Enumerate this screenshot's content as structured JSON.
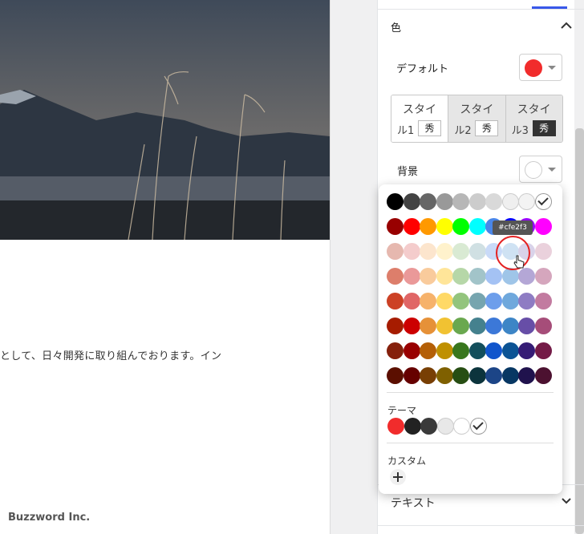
{
  "page": {
    "body_text": "として、日々開発に取り組んでおります。イン",
    "footer_brand": "Buzzword Inc."
  },
  "panel": {
    "color_heading": "色",
    "default_label": "デフォルト",
    "default_color": "#f12c2c",
    "styles": [
      {
        "line1": "スタイ",
        "line2": "ル1",
        "badge": "秀"
      },
      {
        "line1": "スタイ",
        "line2": "ル2",
        "badge": "秀"
      },
      {
        "line1": "スタイ",
        "line2": "ル3",
        "badge": "秀"
      }
    ],
    "background_label": "背景",
    "text_heading": "テキスト"
  },
  "picker": {
    "tooltip": "#cfe2f3",
    "theme_label": "テーマ",
    "custom_label": "カスタム",
    "palette": [
      [
        "#000000",
        "#434343",
        "#666666",
        "#999999",
        "#b7b7b7",
        "#cccccc",
        "#d9d9d9",
        "#efefef",
        "#f3f3f3",
        "#ffffff"
      ],
      [
        "#980000",
        "#ff0000",
        "#ff9900",
        "#ffff00",
        "#00ff00",
        "#00ffff",
        "#4a86e8",
        "#0000ff",
        "#9900ff",
        "#ff00ff"
      ],
      [
        "#e6b8af",
        "#f4cccc",
        "#fce5cd",
        "#fff2cc",
        "#d9ead3",
        "#d0e0e3",
        "#c9daf8",
        "#cfe2f3",
        "#d9d2e9",
        "#ead1dc"
      ],
      [
        "#dd7e6b",
        "#ea9999",
        "#f9cb9c",
        "#ffe599",
        "#b6d7a8",
        "#a2c4c9",
        "#a4c2f4",
        "#9fc5e8",
        "#b4a7d6",
        "#d5a6bd"
      ],
      [
        "#cc4125",
        "#e06666",
        "#f6b26b",
        "#ffd966",
        "#93c47d",
        "#76a5af",
        "#6d9eeb",
        "#6fa8dc",
        "#8e7cc3",
        "#c27ba0"
      ],
      [
        "#a61c00",
        "#cc0000",
        "#e69138",
        "#f1c232",
        "#6aa84f",
        "#45818e",
        "#3c78d8",
        "#3d85c6",
        "#674ea7",
        "#a64d79"
      ],
      [
        "#85200c",
        "#990000",
        "#b45f06",
        "#bf9000",
        "#38761d",
        "#134f5c",
        "#1155cc",
        "#0b5394",
        "#351c75",
        "#741b47"
      ],
      [
        "#5b0f00",
        "#660000",
        "#783f04",
        "#7f6000",
        "#274e13",
        "#0c343d",
        "#1c4587",
        "#073763",
        "#20124d",
        "#4c1130"
      ]
    ],
    "theme_colors": [
      "#f12c2c",
      "#222222",
      "#3a3a3a",
      "#e8e8e8",
      "#ffffff",
      "#ffffff"
    ]
  }
}
